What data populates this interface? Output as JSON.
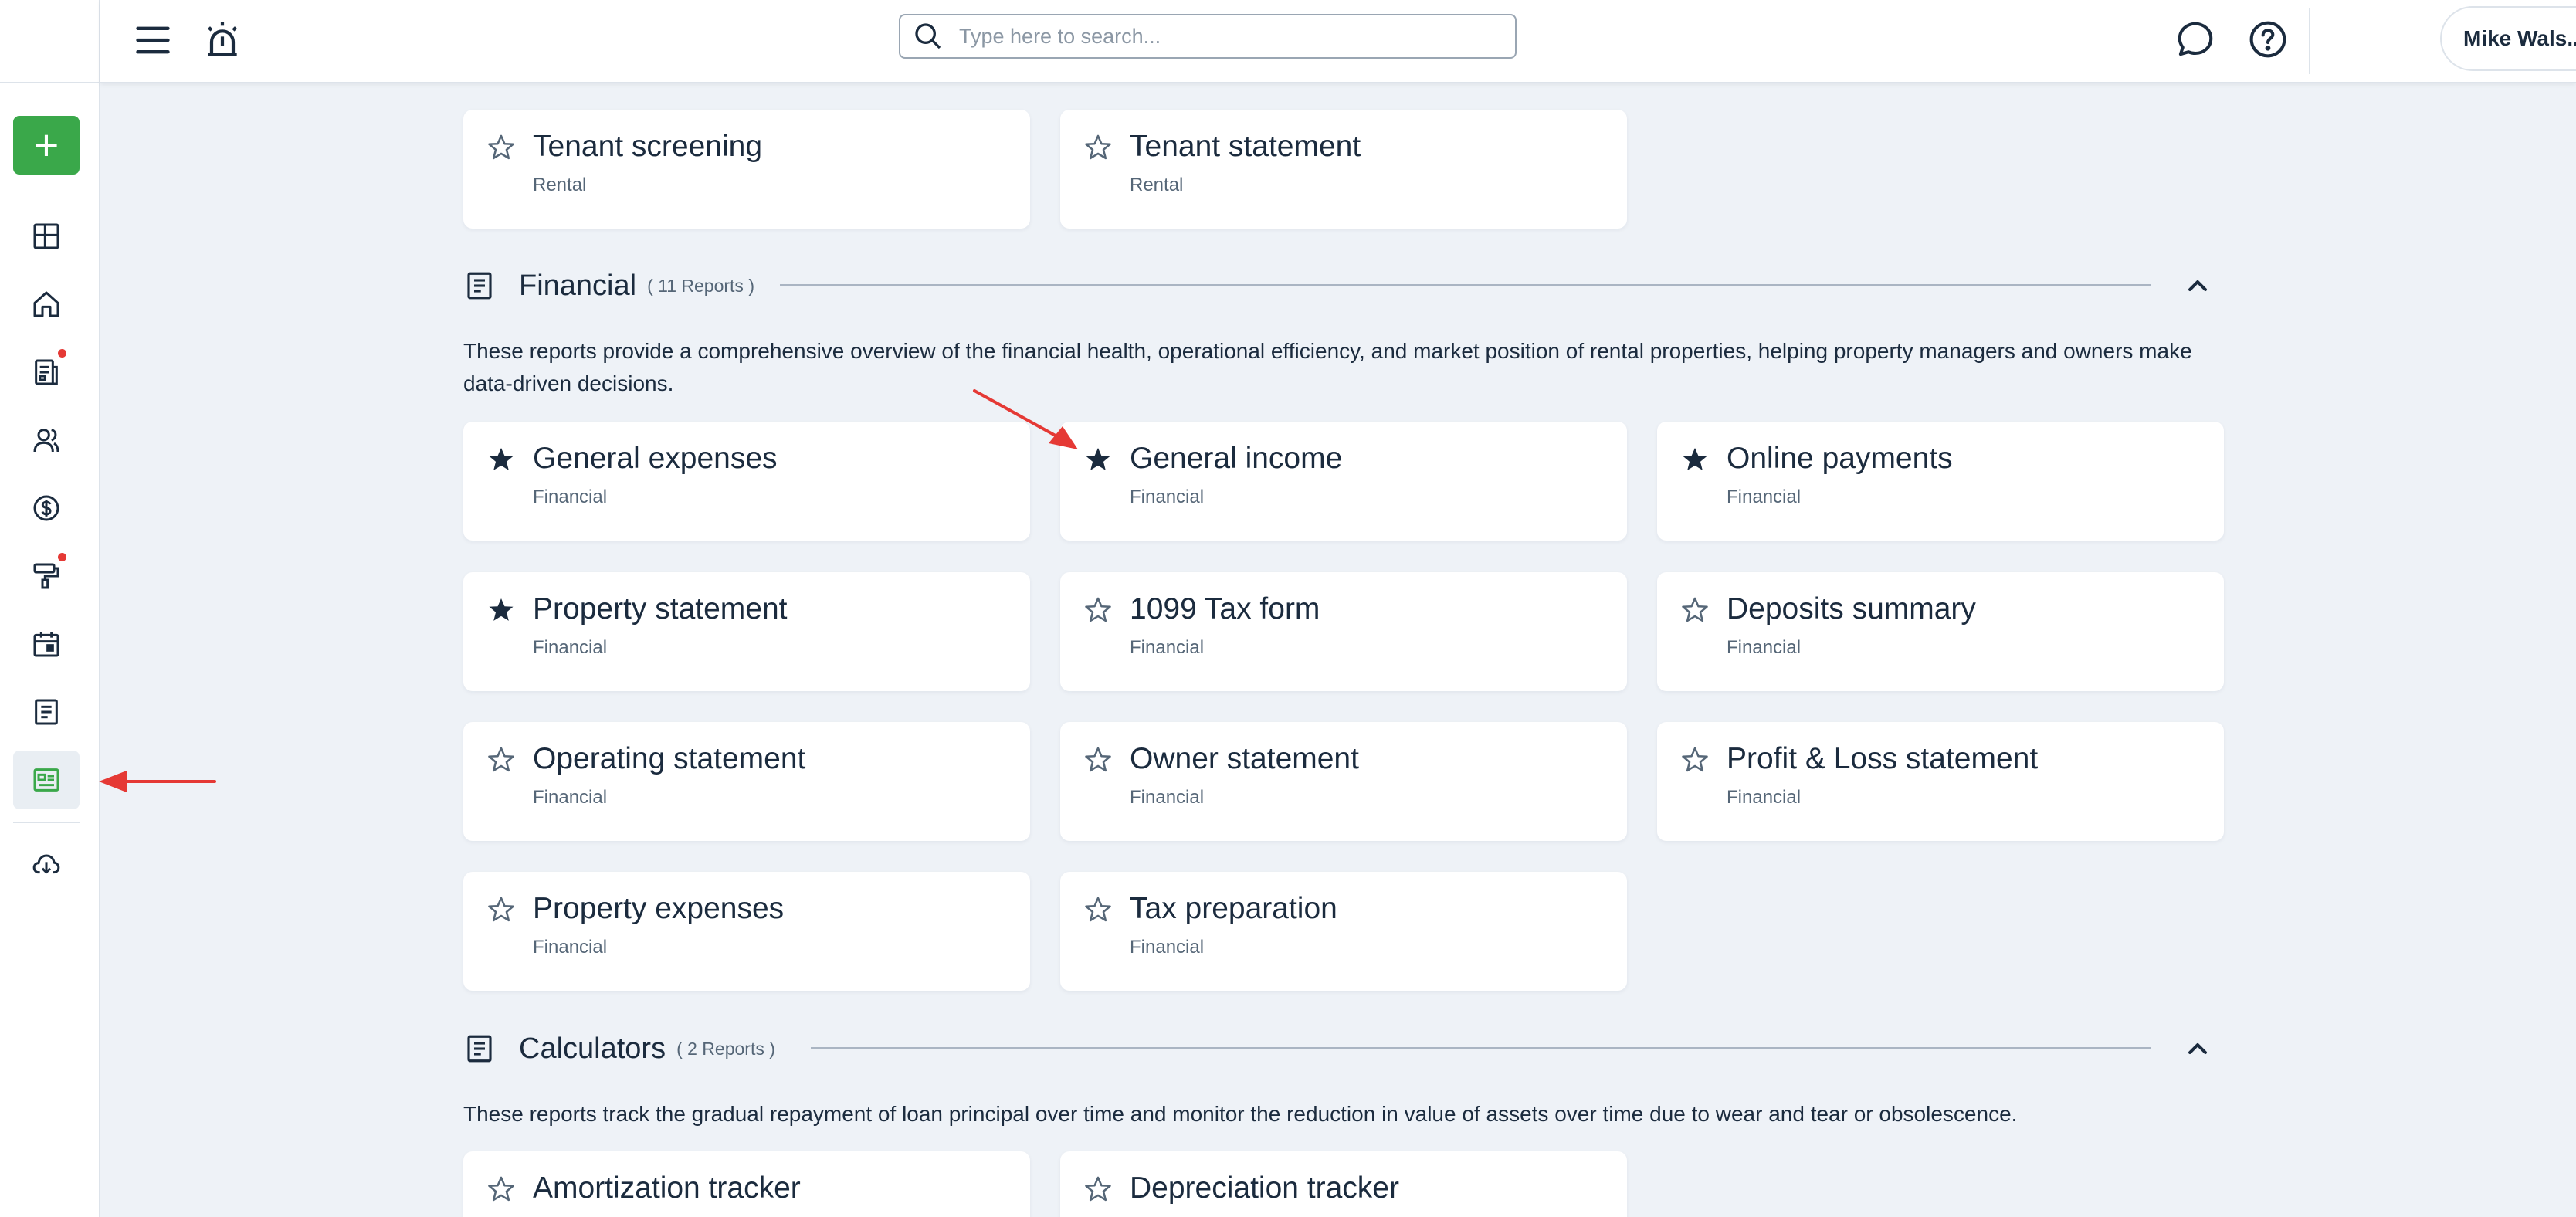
{
  "header": {
    "search_placeholder": "Type here to search...",
    "user_name": "Mike Wals..."
  },
  "sidebar": {
    "items": [
      {
        "icon": "dashboard-icon"
      },
      {
        "icon": "home-icon"
      },
      {
        "icon": "leases-icon",
        "badge": true
      },
      {
        "icon": "people-icon"
      },
      {
        "icon": "dollar-icon"
      },
      {
        "icon": "maintenance-icon",
        "badge": true
      },
      {
        "icon": "calendar-icon"
      },
      {
        "icon": "document-icon"
      },
      {
        "icon": "reports-icon",
        "active": true
      },
      {
        "icon": "cloud-download-icon"
      }
    ]
  },
  "rental_cards": [
    {
      "title": "Tenant screening",
      "category": "Rental",
      "starred": false
    },
    {
      "title": "Tenant statement",
      "category": "Rental",
      "starred": false
    }
  ],
  "financial": {
    "title": "Financial",
    "count": "( 11 Reports )",
    "description": "These reports provide a comprehensive overview of the financial health, operational efficiency, and market position of rental properties, helping property managers and owners make data-driven decisions.",
    "cards": [
      {
        "title": "General expenses",
        "category": "Financial",
        "starred": true
      },
      {
        "title": "General income",
        "category": "Financial",
        "starred": true
      },
      {
        "title": "Online payments",
        "category": "Financial",
        "starred": true
      },
      {
        "title": "Property statement",
        "category": "Financial",
        "starred": true
      },
      {
        "title": "1099 Tax form",
        "category": "Financial",
        "starred": false
      },
      {
        "title": "Deposits summary",
        "category": "Financial",
        "starred": false
      },
      {
        "title": "Operating statement",
        "category": "Financial",
        "starred": false
      },
      {
        "title": "Owner statement",
        "category": "Financial",
        "starred": false
      },
      {
        "title": "Profit & Loss statement",
        "category": "Financial",
        "starred": false
      },
      {
        "title": "Property expenses",
        "category": "Financial",
        "starred": false
      },
      {
        "title": "Tax preparation",
        "category": "Financial",
        "starred": false
      }
    ]
  },
  "calculators": {
    "title": "Calculators",
    "count": "( 2 Reports )",
    "description": "These reports track the gradual repayment of loan principal over time and monitor the reduction in value of assets over time due to wear and tear or obsolescence.",
    "cards": [
      {
        "title": "Amortization tracker",
        "starred": false
      },
      {
        "title": "Depreciation tracker",
        "starred": false
      }
    ]
  },
  "colors": {
    "accent_green": "#3aa84a",
    "annotation_red": "#e53935",
    "text_dark": "#1b2b3e",
    "background": "#eef2f7"
  }
}
